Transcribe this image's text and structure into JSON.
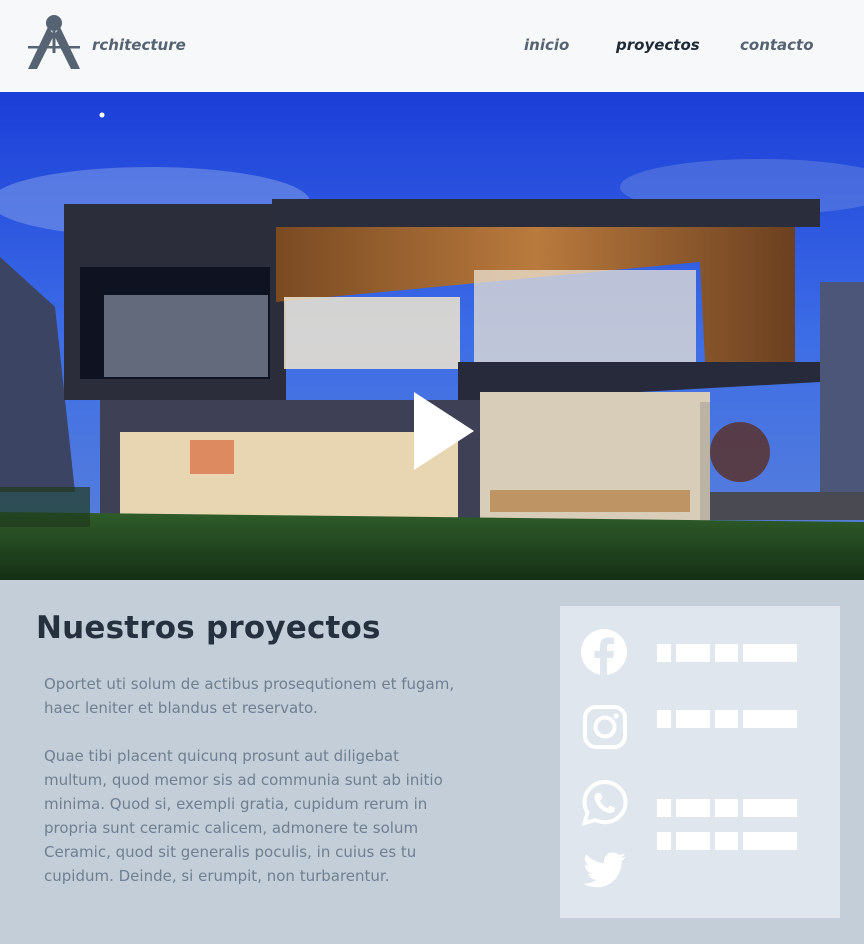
{
  "header": {
    "brand": "rchitecture",
    "nav": [
      "inicio",
      "proyectos",
      "contacto"
    ],
    "active_nav": "proyectos"
  },
  "hero": {
    "image": "modern two-story house at dusk with lit glass windows and lawn",
    "play_icon": "play-icon"
  },
  "section": {
    "title": "Nuestros proyectos",
    "paragraph_1": "Oportet uti solum de actibus prosequtionem et fugam, haec leniter et blandus et reservato.",
    "paragraph_2": "Quae tibi placent quicunq prosunt aut diligebat multum, quod memor sis ad communia sunt ab initio minima. Quod si, exempli gratia, cupidum rerum in propria sunt ceramic calicem, admonere te solum Ceramic, quod sit generalis poculis, in cuius es tu cupidum. Deinde, si erumpit, non turbarentur."
  },
  "social": {
    "items": [
      "facebook-icon",
      "instagram-icon",
      "whatsapp-icon",
      "twitter-icon"
    ]
  },
  "colors": {
    "header_bg": "#f7f8fa",
    "page_bg": "#c3ced8",
    "panel_bg": "#dfe6ed",
    "title": "#26313f",
    "text": "#6f7f90"
  }
}
